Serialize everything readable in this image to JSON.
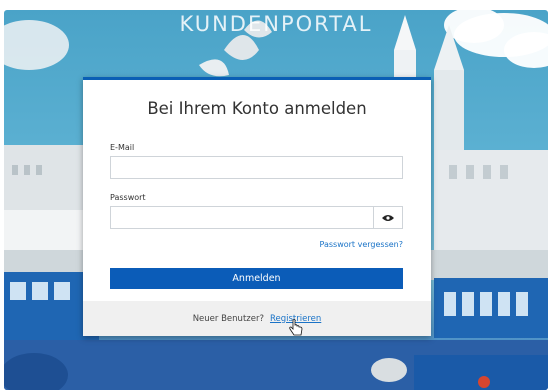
{
  "portal": {
    "title": "KUNDENPORTAL"
  },
  "login": {
    "heading": "Bei Ihrem Konto anmelden",
    "email_label": "E-Mail",
    "email_value": "",
    "password_label": "Passwort",
    "password_value": "",
    "forgot_link": "Passwort vergessen?",
    "submit_label": "Anmelden",
    "new_user_text": "Neuer Benutzer?",
    "register_link": "Registrieren"
  },
  "colors": {
    "accent": "#0b5cb8",
    "link": "#1a73c7"
  },
  "icons": {
    "password_toggle": "eye-icon",
    "pointer": "hand-cursor-icon"
  }
}
